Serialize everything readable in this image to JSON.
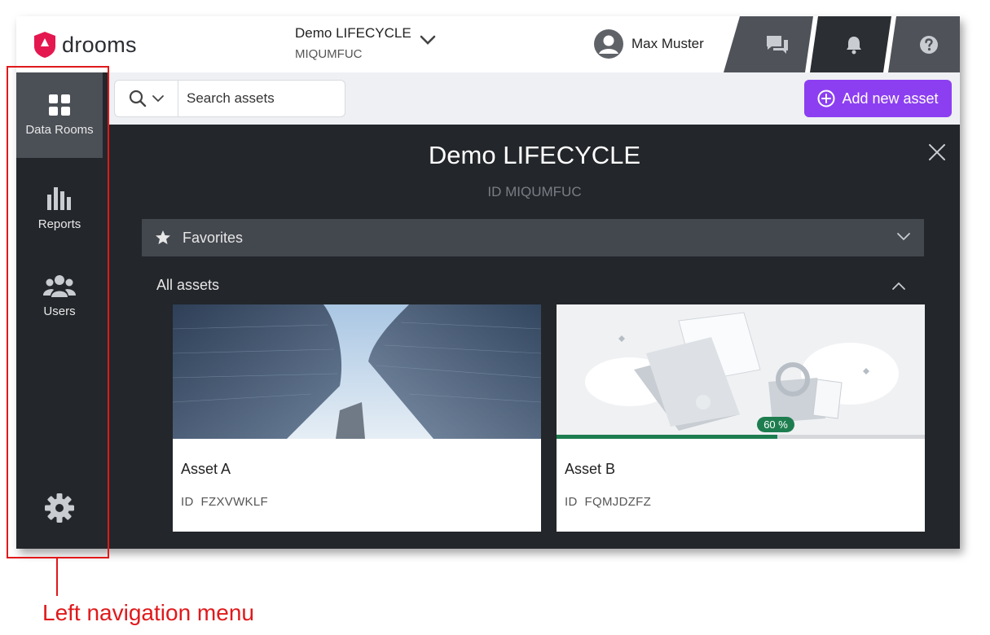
{
  "header": {
    "logo_text": "drooms",
    "room_title": "Demo LIFECYCLE",
    "room_id": "MIQUMFUC",
    "user_name": "Max Muster",
    "tabs": [
      {
        "icon": "chat-icon"
      },
      {
        "icon": "bell-icon"
      },
      {
        "icon": "help-icon"
      }
    ]
  },
  "sidebar": {
    "items": [
      {
        "label": "Data Rooms",
        "icon": "grid-icon",
        "active": true
      },
      {
        "label": "Reports",
        "icon": "bar-chart-icon"
      },
      {
        "label": "Users",
        "icon": "users-icon"
      }
    ],
    "settings_icon": "gear-icon"
  },
  "toolbar": {
    "search_placeholder": "Search assets",
    "add_label": "Add new asset"
  },
  "main": {
    "title": "Demo LIFECYCLE",
    "id_line": "ID MIQUMFUC",
    "favorites_label": "Favorites",
    "all_assets_label": "All assets",
    "assets": [
      {
        "name": "Asset A",
        "id_prefix": "ID",
        "id": "FZXVWKLF"
      },
      {
        "name": "Asset B",
        "id_prefix": "ID",
        "id": "FQMJDZFZ",
        "progress": 60,
        "progress_label": "60 %"
      }
    ]
  },
  "annotation": {
    "label": "Left navigation menu"
  },
  "colors": {
    "brand_red": "#e4184f",
    "accent_purple": "#8c3ff1",
    "progress_green": "#1e7d4f",
    "annotation_red": "#e0191b",
    "nav_bg": "#23262a"
  }
}
